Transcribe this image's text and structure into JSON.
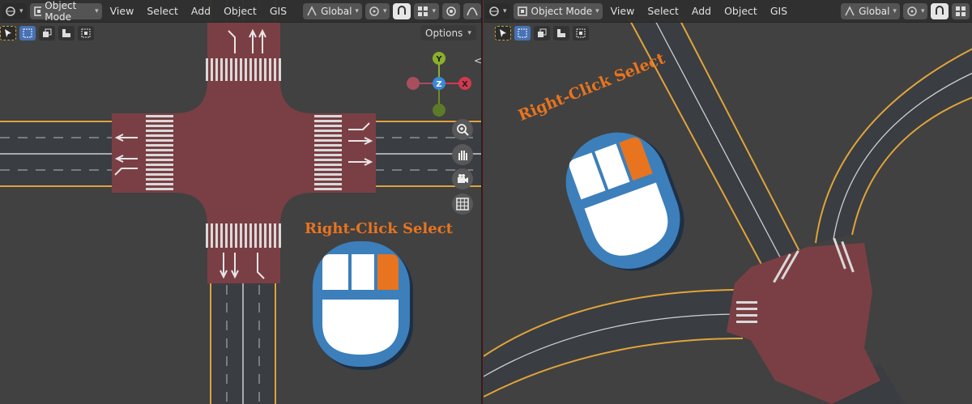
{
  "left_view": {
    "header": {
      "mode_label": "Object Mode",
      "menus": [
        "View",
        "Select",
        "Add",
        "Object",
        "GIS"
      ],
      "transform_orientation": "Global"
    },
    "options_label": "Options",
    "gizmo": {
      "axis_y": "Y",
      "axis_z": "Z",
      "axis_x": "X"
    },
    "overlay_text": "Right-Click Select"
  },
  "right_view": {
    "header": {
      "mode_label": "Object Mode",
      "menus": [
        "View",
        "Select",
        "Add",
        "Object",
        "GIS"
      ],
      "transform_orientation": "Global"
    },
    "overlay_text": "Right-Click Select"
  },
  "colors": {
    "road": "#3a3d42",
    "intersection": "#7a3f44",
    "mouse_blue": "#3c7fbb",
    "mouse_accent": "#e8741f",
    "lane_yellow": "#e0a43a"
  },
  "icons": [
    "cursor-icon",
    "object-mode-icon",
    "snap-icon",
    "proportional-icon",
    "zoom-icon",
    "hand-icon",
    "camera-icon",
    "grid-icon",
    "mouse-icon"
  ]
}
